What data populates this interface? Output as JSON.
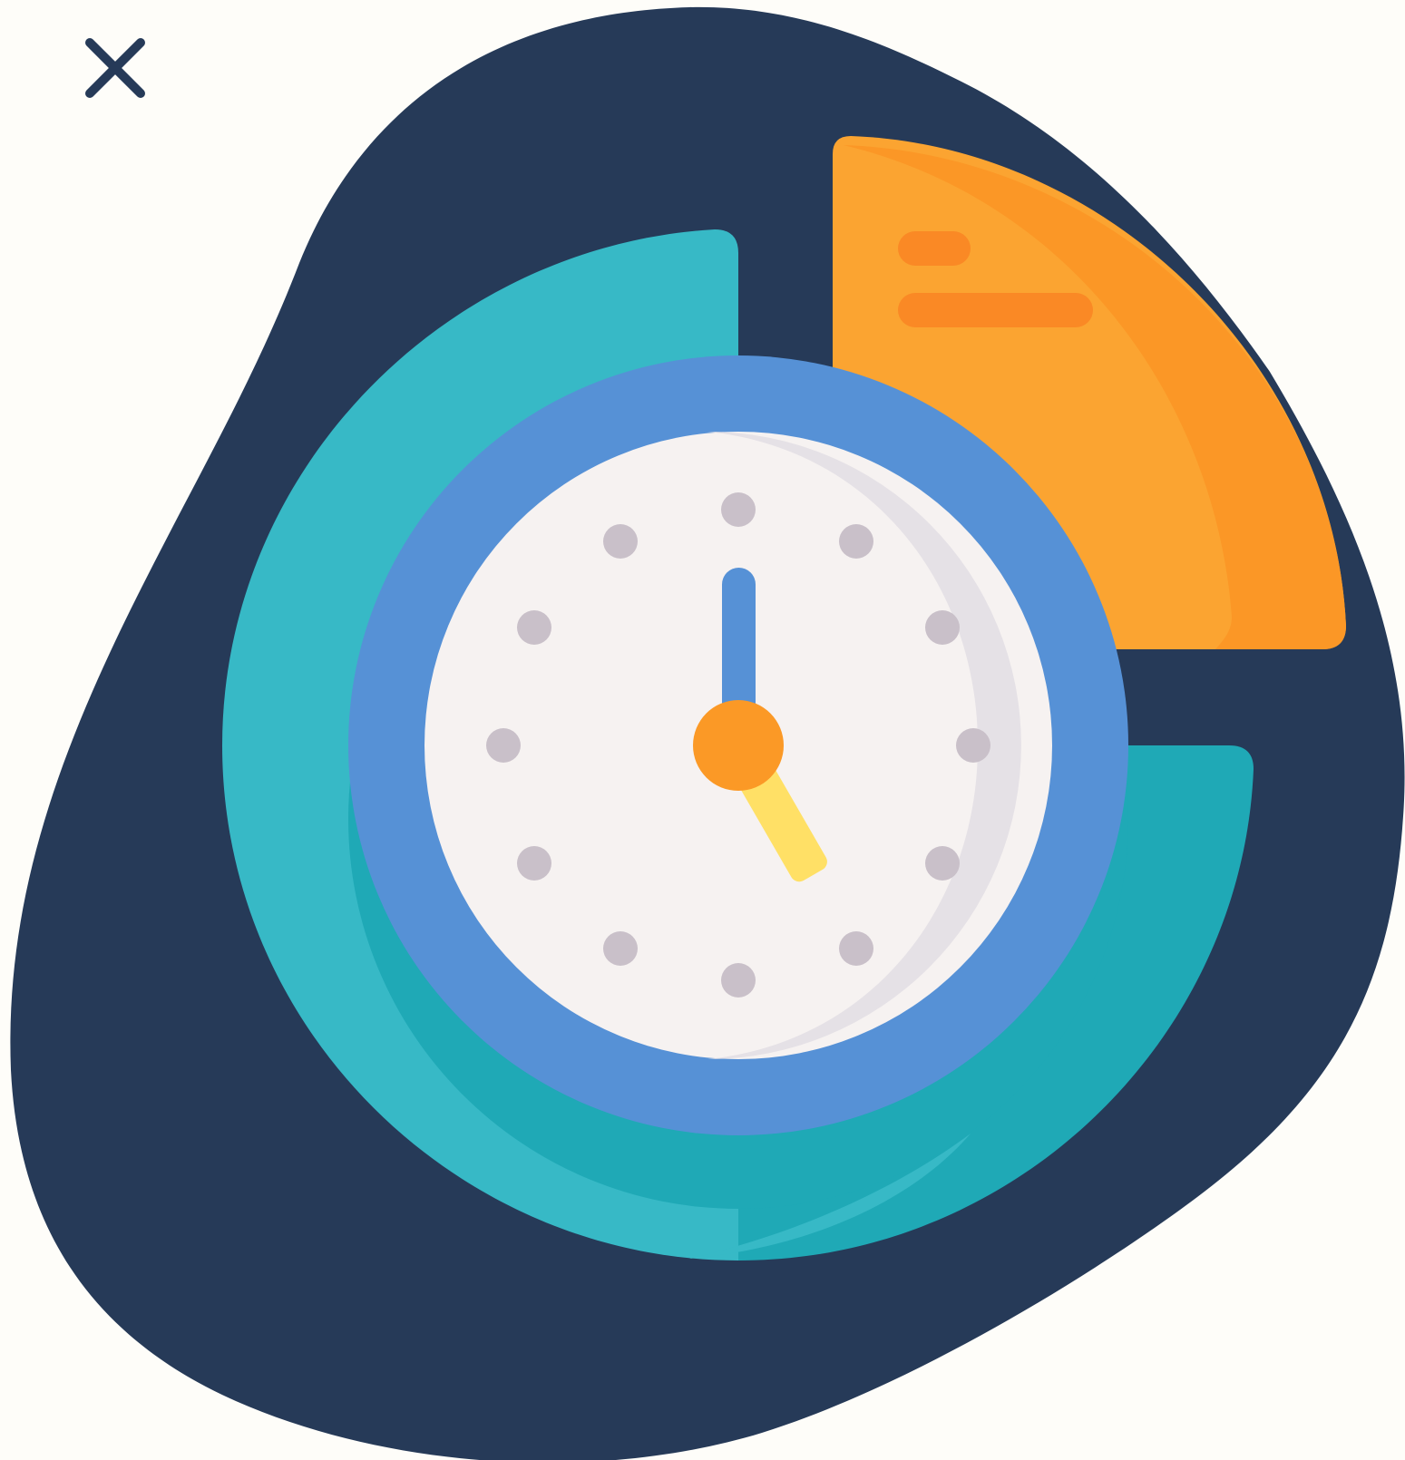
{
  "dialog": {
    "close_icon": "close-icon",
    "close_color": "#263a58"
  },
  "illustration": {
    "subject": "clock-icon",
    "colors": {
      "background": "#fefdf9",
      "blob": "#263a58",
      "teal_light": "#37b9c6",
      "teal_dark": "#1fa9b6",
      "blue_ring": "#5691d6",
      "face": "#f6f2f1",
      "face_shade": "#e5e1e6",
      "tick": "#c9c0c9",
      "hour_hand": "#ffe066",
      "minute_hand": "#5691d6",
      "hub": "#fb9926",
      "card_light": "#fba431",
      "card_dark": "#fb9726",
      "card_lines": "#fa8925"
    },
    "clock_time": "5:00"
  }
}
